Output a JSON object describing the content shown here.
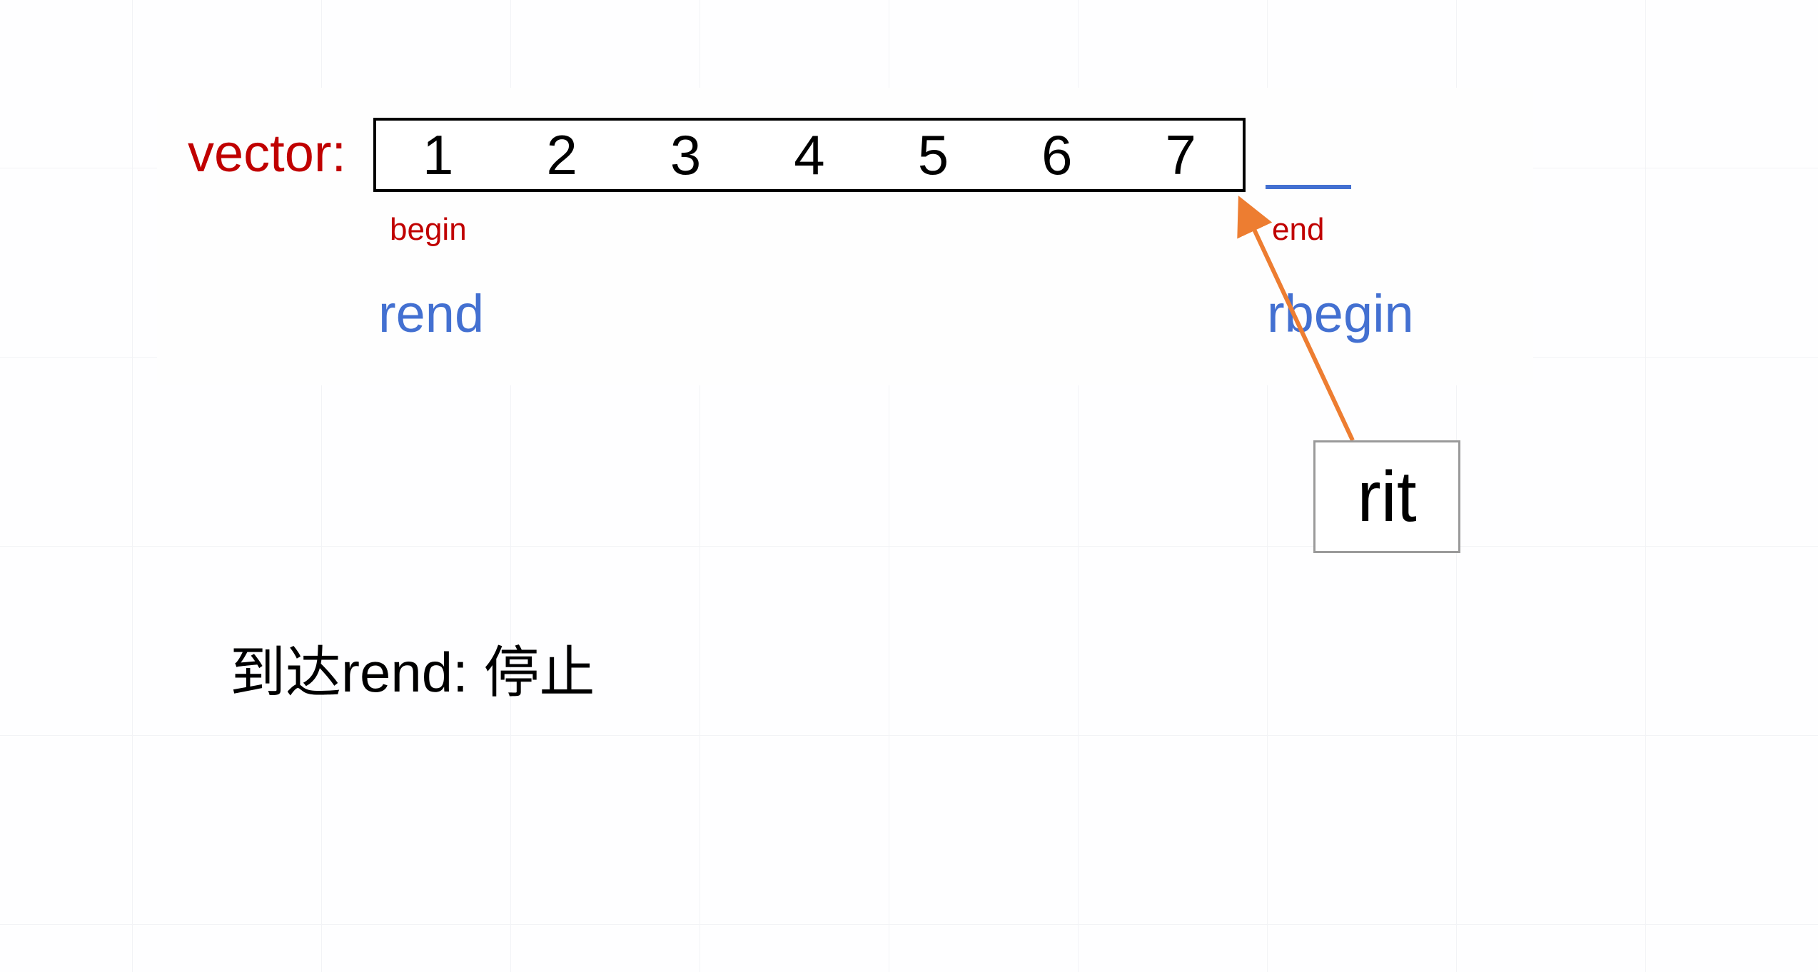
{
  "vector_label": "vector:",
  "cells": [
    "1",
    "2",
    "3",
    "4",
    "5",
    "6",
    "7"
  ],
  "begin_label": "begin",
  "end_label": "end",
  "rend_label": "rend",
  "rbegin_label": "rbegin",
  "rit_label": "rit",
  "note": "到达rend: 停止",
  "colors": {
    "accent_red": "#c00000",
    "accent_blue": "#4370d1",
    "arrow_orange": "#ed7d31"
  },
  "chart_data": {
    "type": "table",
    "title": "vector reverse iterator diagram",
    "values": [
      1,
      2,
      3,
      4,
      5,
      6,
      7
    ],
    "iterators": {
      "begin": 0,
      "end": 7,
      "rbegin": 7,
      "rend": 0,
      "rit": 7
    },
    "annotation": "到达rend: 停止"
  }
}
